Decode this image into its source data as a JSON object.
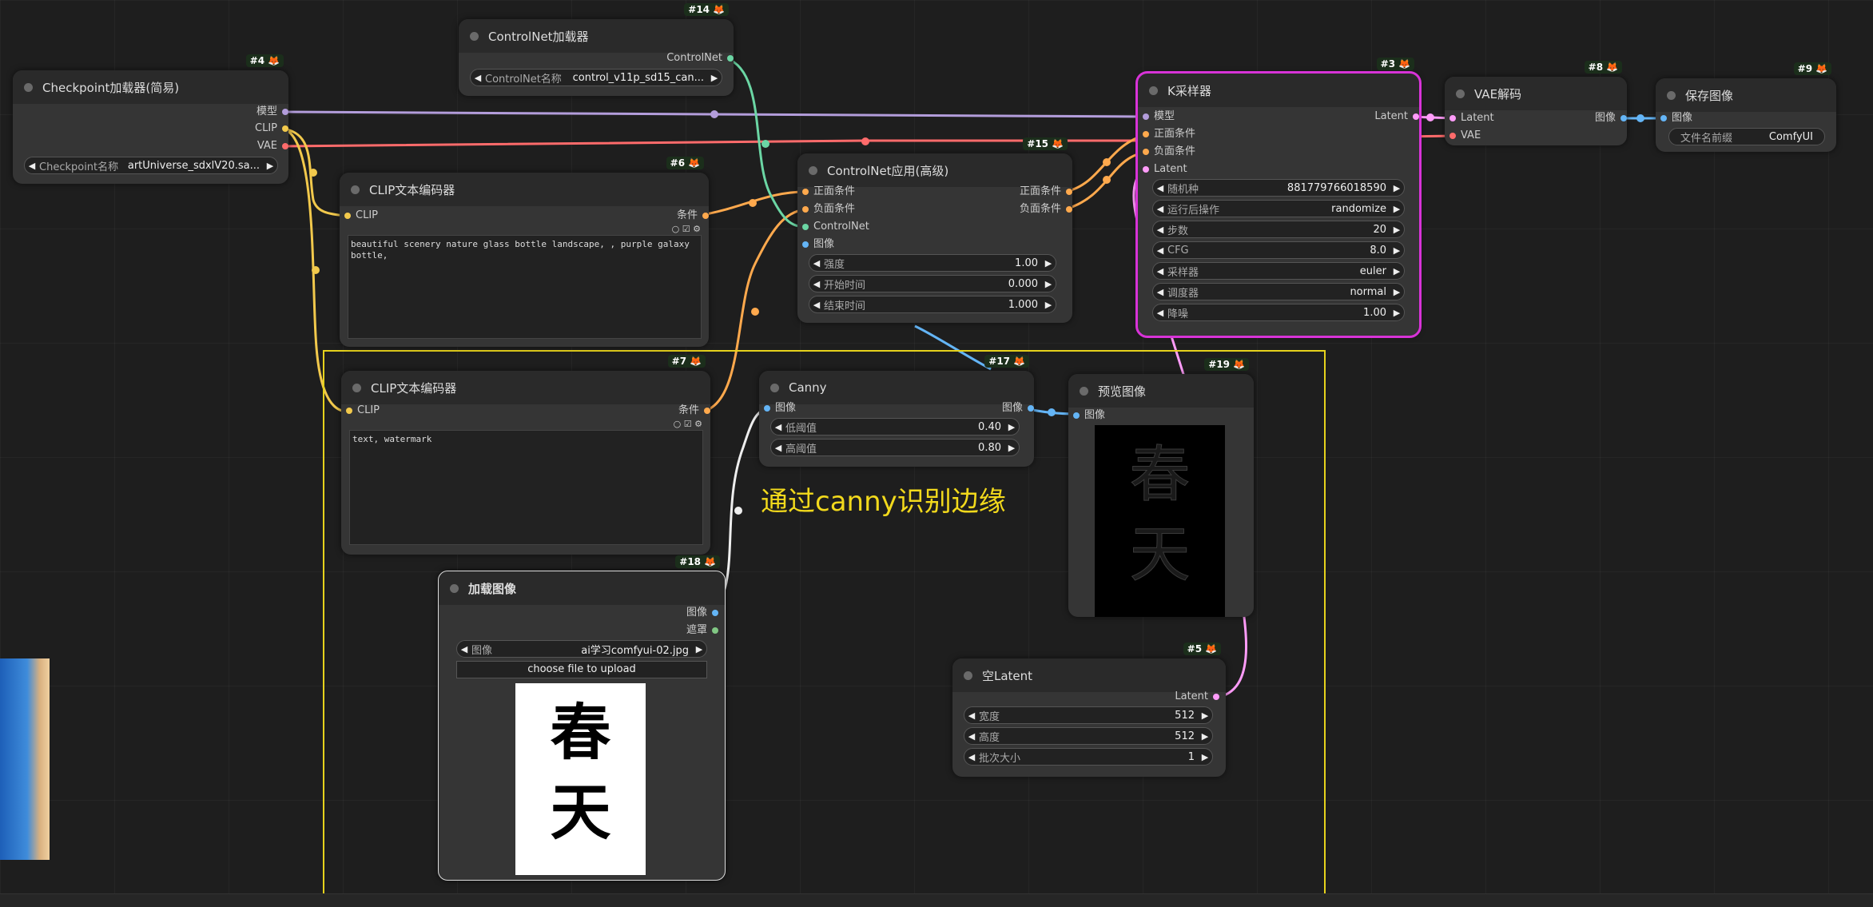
{
  "colors": {
    "clip": "#f2c94c",
    "model": "#b39ddb",
    "vae": "#ff6b6b",
    "cond": "#ffa94d",
    "latent": "#ff9cf9",
    "image": "#64b5f6",
    "control": "#6bd6a4",
    "mask": "#81c784"
  },
  "annotation": "通过canny识别边缘",
  "nodes": {
    "checkpoint": {
      "id": "#4",
      "title": "Checkpoint加载器(简易)",
      "out_model": "模型",
      "out_clip": "CLIP",
      "out_vae": "VAE",
      "w_label": "Checkpoint名称",
      "w_value": "artUniverse_sdxlV20.sa..."
    },
    "controlnet_loader": {
      "id": "#14",
      "title": "ControlNet加载器",
      "out_cn": "ControlNet",
      "w_label": "ControlNet名称",
      "w_value": "control_v11p_sd15_can..."
    },
    "clip_pos": {
      "id": "#6",
      "title": "CLIP文本编码器",
      "in_clip": "CLIP",
      "out_cond": "条件",
      "text": "beautiful scenery nature glass bottle landscape, , purple galaxy bottle,"
    },
    "clip_neg": {
      "id": "#7",
      "title": "CLIP文本编码器",
      "in_clip": "CLIP",
      "out_cond": "条件",
      "text": "text, watermark"
    },
    "cn_apply": {
      "id": "#15",
      "title": "ControlNet应用(高级)",
      "in_pos": "正面条件",
      "in_neg": "负面条件",
      "in_cn": "ControlNet",
      "in_img": "图像",
      "out_pos": "正面条件",
      "out_neg": "负面条件",
      "widgets": [
        {
          "label": "强度",
          "value": "1.00"
        },
        {
          "label": "开始时间",
          "value": "0.000"
        },
        {
          "label": "结束时间",
          "value": "1.000"
        }
      ]
    },
    "ksampler": {
      "id": "#3",
      "title": "K采样器",
      "in_model": "模型",
      "in_pos": "正面条件",
      "in_neg": "负面条件",
      "in_latent": "Latent",
      "out_latent": "Latent",
      "widgets": [
        {
          "label": "随机种",
          "value": "881779766018590"
        },
        {
          "label": "运行后操作",
          "value": "randomize"
        },
        {
          "label": "步数",
          "value": "20"
        },
        {
          "label": "CFG",
          "value": "8.0"
        },
        {
          "label": "采样器",
          "value": "euler"
        },
        {
          "label": "调度器",
          "value": "normal"
        },
        {
          "label": "降噪",
          "value": "1.00"
        }
      ]
    },
    "vae_decode": {
      "id": "#8",
      "title": "VAE解码",
      "in_latent": "Latent",
      "in_vae": "VAE",
      "out_img": "图像"
    },
    "save_image": {
      "id": "#9",
      "title": "保存图像",
      "in_img": "图像",
      "w_label": "文件名前缀",
      "w_value": "ComfyUI"
    },
    "canny": {
      "id": "#17",
      "title": "Canny",
      "in_img": "图像",
      "out_img": "图像",
      "widgets": [
        {
          "label": "低阈值",
          "value": "0.40"
        },
        {
          "label": "高阈值",
          "value": "0.80"
        }
      ]
    },
    "preview": {
      "id": "#19",
      "title": "预览图像",
      "in_img": "图像",
      "preview_text": "春天"
    },
    "load_image": {
      "id": "#18",
      "title": "加载图像",
      "out_img": "图像",
      "out_mask": "遮罩",
      "w_label": "图像",
      "w_value": "ai学习comfyui-02.jpg",
      "upload": "choose file to upload",
      "image_text": "春天"
    },
    "empty_latent": {
      "id": "#5",
      "title": "空Latent",
      "out_latent": "Latent",
      "widgets": [
        {
          "label": "宽度",
          "value": "512"
        },
        {
          "label": "高度",
          "value": "512"
        },
        {
          "label": "批次大小",
          "value": "1"
        }
      ]
    }
  }
}
